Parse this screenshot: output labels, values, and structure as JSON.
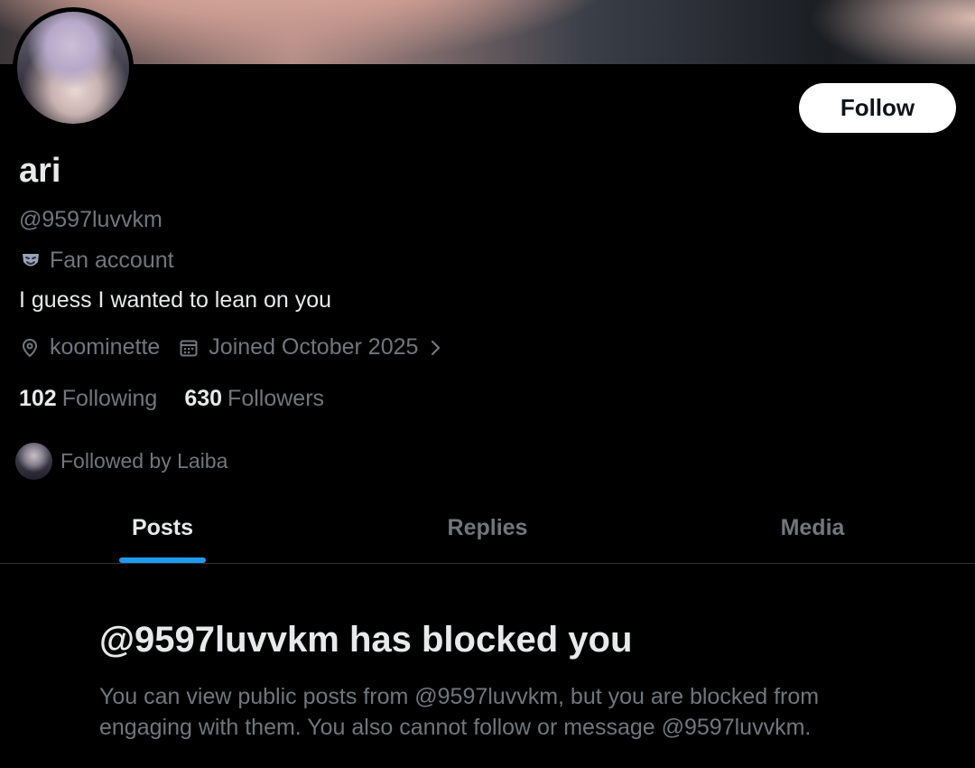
{
  "profile": {
    "name": "ari",
    "handle": "@9597luvvkm",
    "category": "Fan account",
    "bio": "I guess I wanted to lean on you",
    "location": "koominette",
    "joined": "Joined October 2025",
    "follow_label": "Follow",
    "following_count": "102",
    "following_label": "Following",
    "followers_count": "630",
    "followers_label": "Followers",
    "followed_by": "Followed by Laiba"
  },
  "tabs": [
    {
      "label": "Posts",
      "active": true
    },
    {
      "label": "Replies",
      "active": false
    },
    {
      "label": "Media",
      "active": false
    }
  ],
  "blocked": {
    "title": "@9597luvvkm has blocked you",
    "description": "You can view public posts from @9597luvvkm, but you are blocked from engaging with them. You also cannot follow or message @9597luvvkm."
  },
  "icons": {
    "category": "theater-mask-icon",
    "location": "location-pin-icon",
    "joined": "calendar-icon",
    "more": "chevron-right-icon"
  },
  "colors": {
    "background": "#000000",
    "primary_text": "#e7e9ea",
    "secondary_text": "#71767b",
    "accent": "#1d9bf0",
    "divider": "#2f3336"
  }
}
